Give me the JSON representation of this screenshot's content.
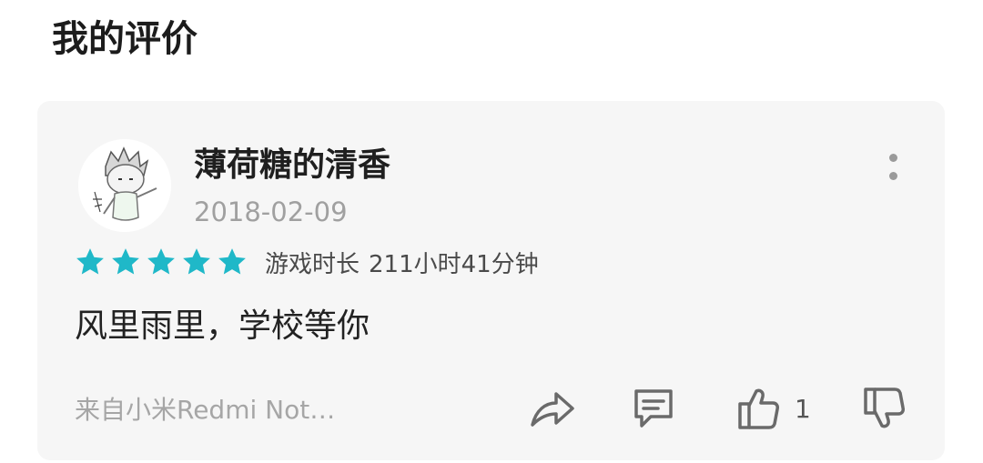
{
  "section": {
    "title": "我的评价"
  },
  "review": {
    "user_name": "薄荷糖的清香",
    "date": "2018-02-09",
    "rating": 5,
    "rating_max": 5,
    "playtime_label": "游戏时长",
    "playtime_value": "211小时41分钟",
    "text": "风里雨里，学校等你",
    "device_source": "来自小米Redmi Not…",
    "like_count": "1",
    "star_color": "#1fb8c8"
  },
  "icons": {
    "more": "more-vertical-icon",
    "share": "share-icon",
    "comment": "comment-icon",
    "like": "thumbs-up-icon",
    "dislike": "thumbs-down-icon"
  }
}
